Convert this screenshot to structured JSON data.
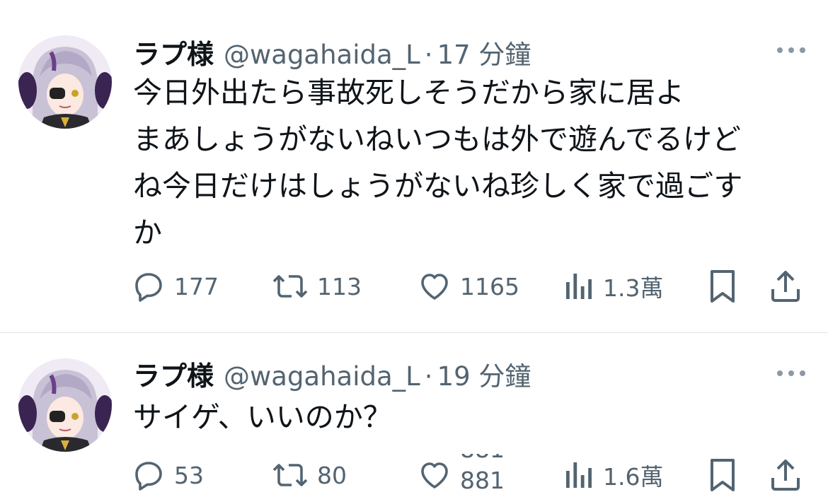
{
  "colors": {
    "text": "#0f1419",
    "secondary": "#536471",
    "divider": "#e1e5e8",
    "avatar_accent": "#6b3f8a"
  },
  "tweets": [
    {
      "name": "ラプ様",
      "handle": "@wagahaida_L",
      "separator": "·",
      "time": "17 分鐘",
      "lines": [
        "今日外出たら事故死しそうだから家に居よ",
        "まあしょうがないねいつもは外で遊んでるけど",
        "ね今日だけはしょうがないね珍しく家で過ごす",
        "か"
      ],
      "replies": "177",
      "retweets": "113",
      "likes": "1165",
      "views": "1.3萬"
    },
    {
      "name": "ラプ様",
      "handle": "@wagahaida_L",
      "separator": "·",
      "time": "19 分鐘",
      "lines": [
        "サイゲ、いいのか？"
      ],
      "replies": "53",
      "retweets": "80",
      "likes_rolling": [
        "881",
        "881"
      ],
      "views": "1.6萬"
    }
  ],
  "icons": {
    "reply": "reply-bubble-icon",
    "retweet": "retweet-icon",
    "like": "heart-icon",
    "views": "views-bar-chart-icon",
    "bookmark": "bookmark-icon",
    "share": "share-upload-icon",
    "more": "more-dots-icon"
  }
}
